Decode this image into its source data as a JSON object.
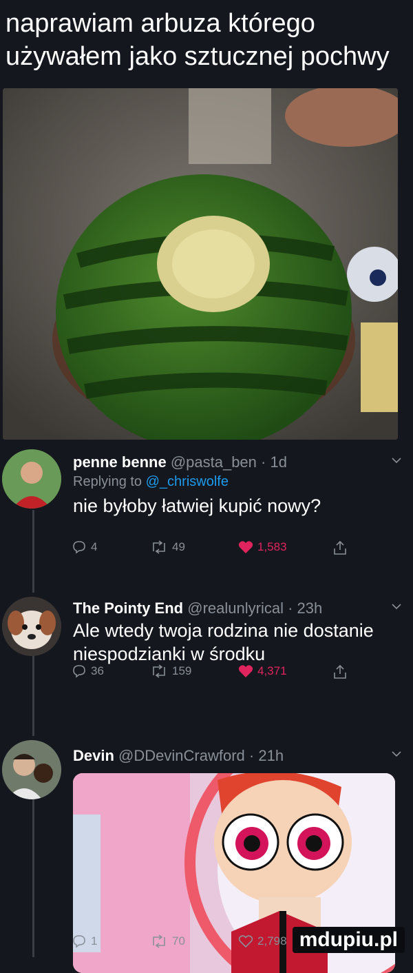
{
  "headline": "naprawiam arbuza którego używałem jako sztucznej pochwy",
  "tweets": [
    {
      "name": "penne benne",
      "handle": "@pasta_ben",
      "time": "1d",
      "reply_prefix": "Replying to",
      "reply_mention": "@_chriswolfe",
      "text": "nie byłoby łatwiej kupić nowy?",
      "replies": "4",
      "retweets": "49",
      "likes": "1,583"
    },
    {
      "name": "The Pointy End",
      "handle": "@realunlyrical",
      "time": "23h",
      "text": "Ale wtedy twoja rodzina nie dostanie niespodzianki w środku",
      "replies": "36",
      "retweets": "159",
      "likes": "4,371"
    },
    {
      "name": "Devin",
      "handle": "@DDevinCrawford",
      "time": "21h",
      "replies": "1",
      "retweets": "70",
      "likes": "2,798"
    }
  ],
  "separator": "·",
  "watermark": "mdupiu.pl",
  "colors": {
    "background": "#14171d",
    "muted": "#8a9099",
    "link": "#1d9bf0",
    "like": "#e0245e"
  }
}
